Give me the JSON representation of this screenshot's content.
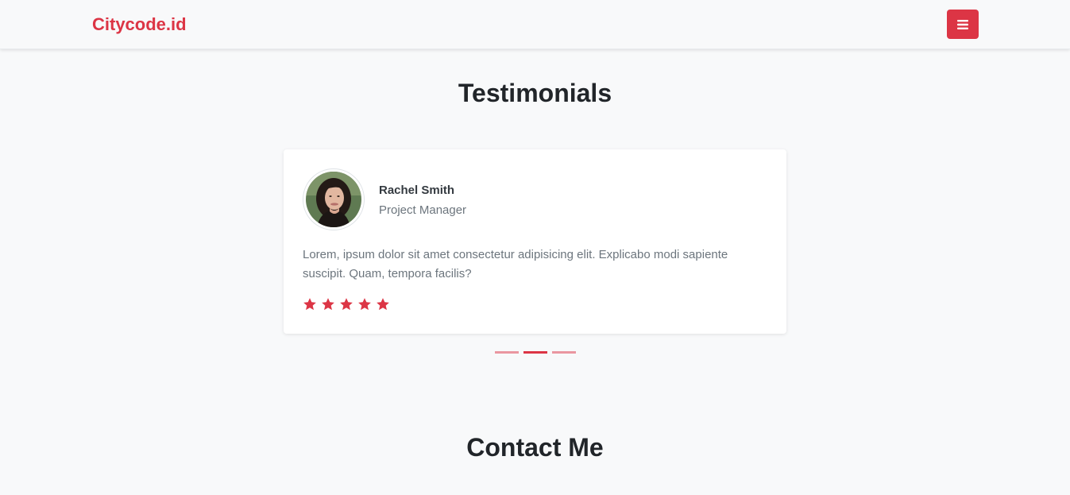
{
  "navbar": {
    "brand": "Citycode.id",
    "toggler_icon": "hamburger-menu-icon"
  },
  "colors": {
    "accent": "#dc3545",
    "background": "#f8f9fa",
    "card": "#ffffff",
    "muted_text": "#6c757d"
  },
  "testimonials": {
    "title": "Testimonials",
    "active_index": 1,
    "slide_count": 3,
    "items": [
      {
        "name": "Rachel Smith",
        "role": "Project Manager",
        "text": "Lorem, ipsum dolor sit amet consectetur adipisicing elit. Explicabo modi sapiente suscipit. Quam, tempora facilis?",
        "rating": 5,
        "rating_max": 5
      }
    ]
  },
  "contact": {
    "title": "Contact Me"
  }
}
